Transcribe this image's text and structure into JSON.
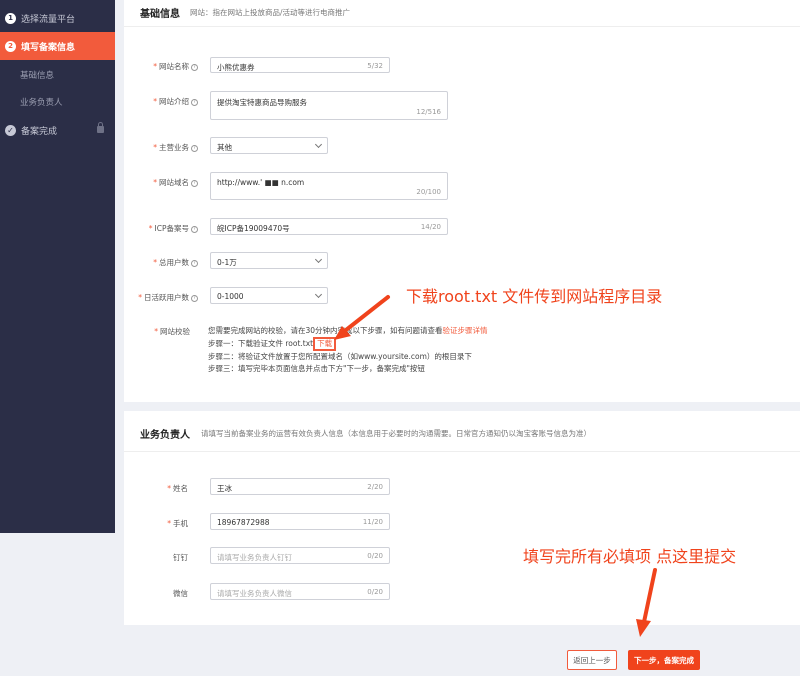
{
  "sidebar": {
    "steps": [
      {
        "num": "1",
        "label": "选择流量平台"
      },
      {
        "num": "2",
        "label": "填写备案信息"
      },
      {
        "label": "备案完成"
      }
    ],
    "substeps": [
      "基础信息",
      "业务负责人"
    ],
    "check_glyph": "✓",
    "lock_icon": "lock-icon"
  },
  "basic": {
    "title": "基础信息",
    "subtitle": "网站：指在网站上投放商品/活动等进行电商推广",
    "fields": {
      "site_name": {
        "label": "网站名称",
        "value": "小熊优惠券",
        "count": "5/32"
      },
      "site_intro": {
        "label": "网站介绍",
        "value": "提供淘宝特惠商品导购服务",
        "count": "12/516"
      },
      "main_business": {
        "label": "主营业务",
        "value": "其他"
      },
      "domain": {
        "label": "网站域名",
        "value": "http://www.'  ■■  n.com",
        "count": "20/100"
      },
      "icp": {
        "label": "ICP备案号",
        "value": "皖ICP备19009470号",
        "count": "14/20"
      },
      "total_users": {
        "label": "总用户数",
        "value": "0-1万"
      },
      "daily_users": {
        "label": "日活跃用户数",
        "value": "0-1000"
      }
    },
    "verify": {
      "label": "网站校验",
      "line1": "您需要完成网站的校验，请在30分钟内完成以下步骤，如有问题请查看",
      "line1_link": "验证步骤详情",
      "step1": "步骤一：下载验证文件 root.txt",
      "step1_link": "下载",
      "step2": "步骤二：将验证文件放置于您所配置域名（如www.yoursite.com）的根目录下",
      "step3": "步骤三：填写完毕本页面信息并点击下方\"下一步，备案完成\"按钮"
    }
  },
  "owner": {
    "title": "业务负责人",
    "subtitle": "请填写当前备案业务的运营有效负责人信息（本信息用于必要时的沟通需要。日常官方通知仍以淘宝客账号信息为准）",
    "fields": {
      "name": {
        "label": "姓名",
        "value": "王冰",
        "count": "2/20"
      },
      "phone": {
        "label": "手机",
        "value": "18967872988",
        "count": "11/20"
      },
      "dingtalk": {
        "label": "钉钉",
        "placeholder": "请填写业务负责人钉钉",
        "count": "0/20"
      },
      "wechat": {
        "label": "微信",
        "placeholder": "请填写业务负责人微信",
        "count": "0/20"
      }
    }
  },
  "buttons": {
    "back": "返回上一步",
    "next": "下一步，备案完成"
  },
  "annotations": {
    "download_hint": "下载root.txt 文件传到网站程序目录",
    "submit_hint": "填写完所有必填项 点这里提交",
    "color": "#f0431c"
  }
}
